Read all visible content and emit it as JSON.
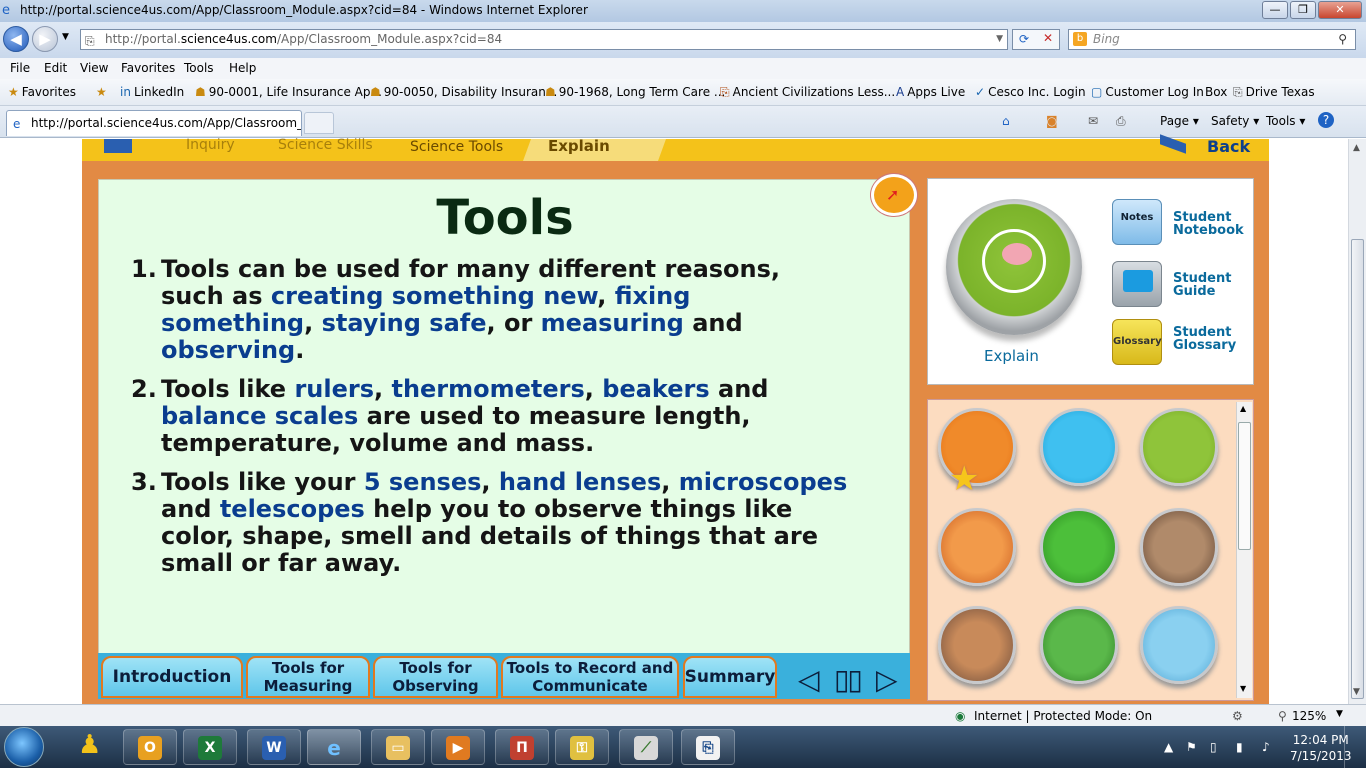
{
  "window": {
    "title": "http://portal.science4us.com/App/Classroom_Module.aspx?cid=84 - Windows Internet Explorer",
    "controls": [
      "—",
      "❐",
      "✕"
    ]
  },
  "address": {
    "prefix": "http://portal.",
    "host": "science4us.com",
    "suffix": "/App/Classroom_Module.aspx?cid=84",
    "search_placeholder": "Bing"
  },
  "menu": [
    "File",
    "Edit",
    "View",
    "Favorites",
    "Tools",
    "Help"
  ],
  "favorites": {
    "label": "Favorites",
    "items": [
      "LinkedIn",
      "90-0001, Life Insurance Ap...",
      "90-0050, Disability Insuran...",
      "90-1968, Long Term Care ...",
      "Ancient Civilizations Less...",
      "Apps Live",
      "Cesco Inc. Login",
      "Customer Log In",
      "Box",
      "Drive Texas"
    ]
  },
  "tab": {
    "label": "http://portal.science4us.com/App/Classroom_M...",
    "toolbar": [
      "Page ▾",
      "Safety ▾",
      "Tools ▾",
      "?"
    ]
  },
  "app": {
    "breadcrumbs": [
      "Inquiry",
      "Science Skills",
      "Science Tools",
      "Explain"
    ],
    "back_label": "Back",
    "content": {
      "title": "Tools",
      "items": [
        {
          "num": "1.",
          "parts": [
            {
              "t": "Tools can be used for many different reasons, such as ",
              "k": false
            },
            {
              "t": "creating something new",
              "k": true
            },
            {
              "t": ", ",
              "k": false
            },
            {
              "t": "fixing something",
              "k": true
            },
            {
              "t": ", ",
              "k": false
            },
            {
              "t": "staying safe",
              "k": true
            },
            {
              "t": ", or ",
              "k": false
            },
            {
              "t": "measuring",
              "k": true
            },
            {
              "t": " and ",
              "k": false
            },
            {
              "t": "observing",
              "k": true
            },
            {
              "t": ".",
              "k": false
            }
          ]
        },
        {
          "num": "2.",
          "parts": [
            {
              "t": "Tools like ",
              "k": false
            },
            {
              "t": "rulers",
              "k": true
            },
            {
              "t": ", ",
              "k": false
            },
            {
              "t": "thermometers",
              "k": true
            },
            {
              "t": ", ",
              "k": false
            },
            {
              "t": "beakers",
              "k": true
            },
            {
              "t": " and ",
              "k": false
            },
            {
              "t": "balance scales",
              "k": true
            },
            {
              "t": " are used to measure length, temperature, volume and mass.",
              "k": false
            }
          ]
        },
        {
          "num": "3.",
          "parts": [
            {
              "t": "Tools like your ",
              "k": false
            },
            {
              "t": "5 senses",
              "k": true
            },
            {
              "t": ", ",
              "k": false
            },
            {
              "t": "hand lenses",
              "k": true
            },
            {
              "t": ", ",
              "k": false
            },
            {
              "t": "microscopes",
              "k": true
            },
            {
              "t": " and ",
              "k": false
            },
            {
              "t": "telescopes",
              "k": true
            },
            {
              "t": " help you to observe things like color, shape, smell and details of things that are small or far away.",
              "k": false
            }
          ]
        }
      ]
    },
    "bottom_tabs": [
      "Introduction",
      "Tools for Measuring",
      "Tools for Observing",
      "Tools to Record and Communicate",
      "Summary"
    ],
    "right_panel": {
      "explain_label": "Explain",
      "notes_icon": "Notes",
      "glossary_icon": "Glossary",
      "links": [
        {
          "label": "Student Notebook",
          "icon": "notebook-icon"
        },
        {
          "label": "Student Guide",
          "icon": "video-guide-icon"
        },
        {
          "label": "Student Glossary",
          "icon": "glossary-book-icon"
        }
      ]
    },
    "grid_icons": [
      "gears-face-icon",
      "plant-face-icon",
      "brain-face-icon",
      "music-art-icon",
      "girl-character-icon",
      "boy-character-icon",
      "man-character-icon",
      "map-park-icon",
      "molecule-icon"
    ],
    "colors": {
      "keyword": "#0a3d8f",
      "panel": "#e5fde6",
      "frame": "#e28a44",
      "nav": "#f4c21a"
    }
  },
  "status": {
    "zone": "Internet | Protected Mode: On",
    "zoom": "125%"
  },
  "taskbar": {
    "time": "12:04 PM",
    "date": "7/15/2013"
  }
}
